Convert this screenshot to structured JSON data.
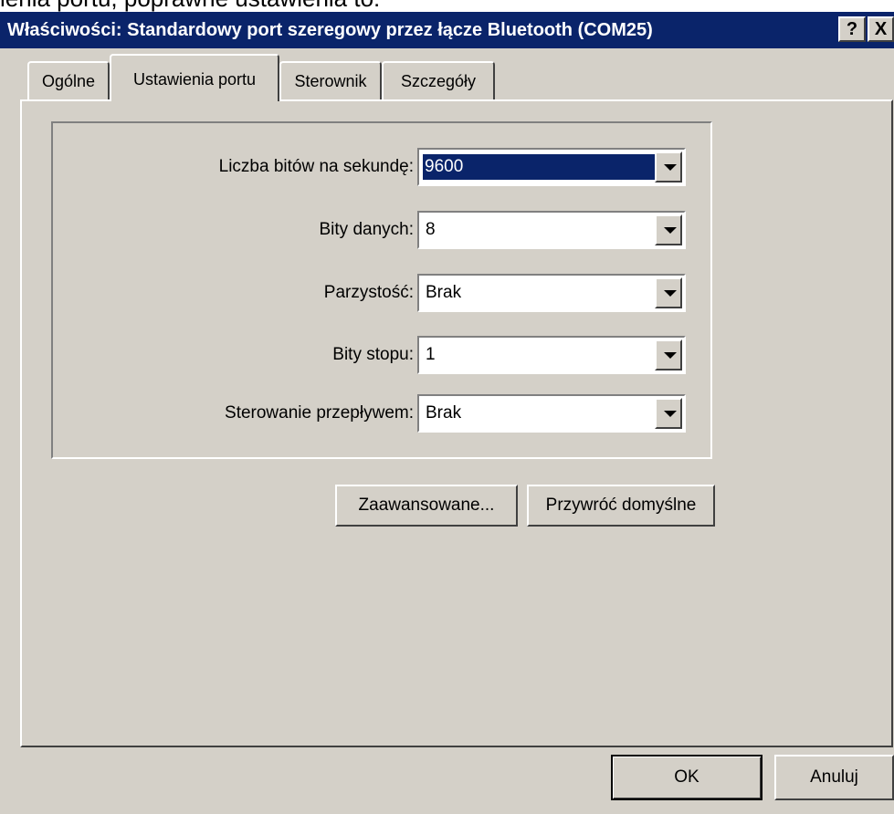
{
  "background_caption": "ienia portu, poprawne ustawienia to:",
  "window": {
    "title": "Właściwości: Standardowy port szeregowy przez łącze Bluetooth (COM25)",
    "help_label": "?",
    "close_label": "X"
  },
  "tabs": [
    {
      "label": "Ogólne"
    },
    {
      "label": "Ustawienia portu"
    },
    {
      "label": "Sterownik"
    },
    {
      "label": "Szczegóły"
    }
  ],
  "fields": [
    {
      "label": "Liczba bitów na sekundę:",
      "value": "9600"
    },
    {
      "label": "Bity danych:",
      "value": "8"
    },
    {
      "label": "Parzystość:",
      "value": "Brak"
    },
    {
      "label": "Bity stopu:",
      "value": "1"
    },
    {
      "label": "Sterowanie przepływem:",
      "value": "Brak"
    }
  ],
  "buttons": {
    "advanced": "Zaawansowane...",
    "restore_defaults": "Przywróć domyślne",
    "ok": "OK",
    "cancel": "Anuluj"
  },
  "colors": {
    "titlebar": "#0a246a",
    "face": "#d4d0c8",
    "selection": "#0a246a"
  }
}
